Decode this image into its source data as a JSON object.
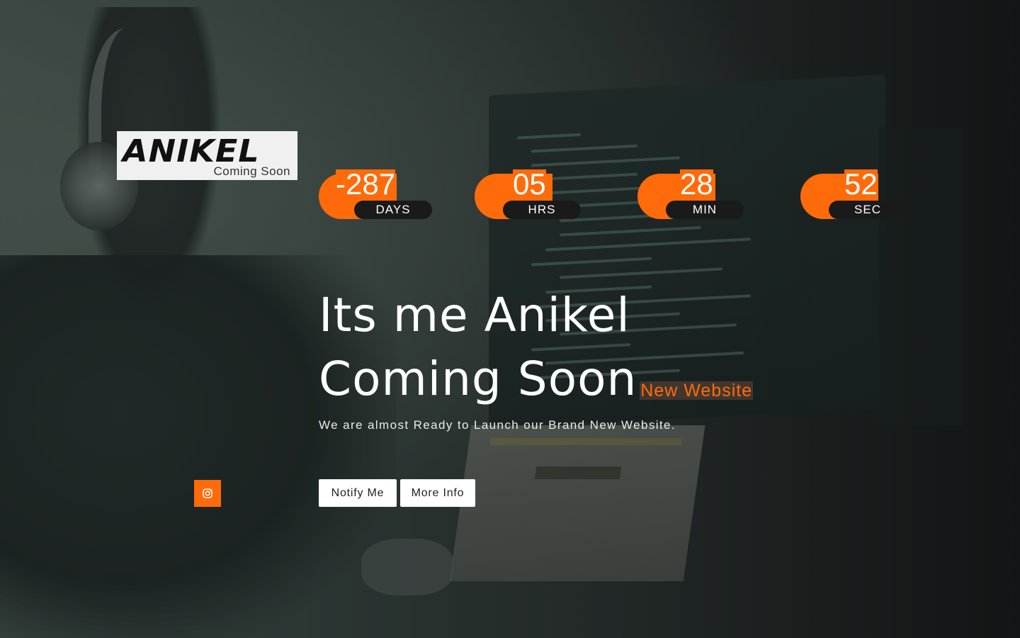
{
  "logo": {
    "title": "ANIKEL",
    "subtitle": "Coming Soon"
  },
  "countdown": [
    {
      "value": "-287",
      "label": "DAYS"
    },
    {
      "value": "05",
      "label": "HRS"
    },
    {
      "value": "28",
      "label": "MIN"
    },
    {
      "value": "52",
      "label": "SEC"
    }
  ],
  "hero": {
    "line1": "Its me Anikel",
    "line2": "Coming Soon",
    "tag": "New Website",
    "subtitle": "We are almost Ready to Launch our Brand New Website."
  },
  "buttons": {
    "notify": "Notify Me",
    "more": "More Info"
  },
  "social": {
    "icon": "instagram-icon"
  },
  "colors": {
    "accent": "#ff6b0a",
    "label_bg": "#1a1a1a",
    "button_bg": "#ffffff"
  }
}
